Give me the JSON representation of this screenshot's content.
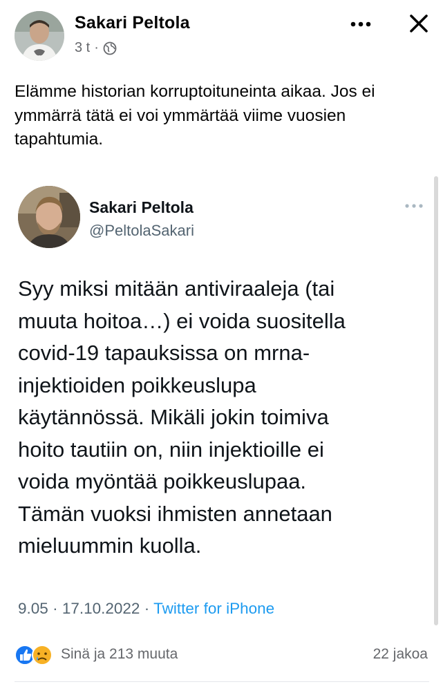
{
  "post": {
    "author_name": "Sakari Peltola",
    "time_ago": "3 t",
    "separator": "·",
    "audience_icon": "globe-icon",
    "text": "Elämme historian korruptoituneinta aikaa. Jos ei ymmärrä tätä ei voi ymmärtää viime vuosien tapahtumia."
  },
  "header_actions": {
    "more_icon": "more-dots-icon",
    "close_icon": "close-icon"
  },
  "tweet": {
    "name": "Sakari Peltola",
    "handle": "@PeltolaSakari",
    "lines": [
      "Syy miksi mitään antiviraaleja (tai",
      "muuta hoitoa…) ei voida suositella",
      "covid-19 tapauksissa on mrna-",
      "injektioiden poikkeuslupa",
      "käytännössä. Mikäli jokin toimiva",
      "hoito tautiin on, niin injektioille ei",
      "voida myöntää poikkeuslupaa.",
      "Tämän vuoksi ihmisten annetaan",
      "mieluummin kuolla."
    ],
    "time": "9.05",
    "date": "17.10.2022",
    "dot": "·",
    "source": "Twitter for iPhone"
  },
  "reactions": {
    "icons": [
      "like-icon",
      "sad-icon"
    ],
    "count_text": "Sinä ja 213 muuta",
    "shares_text": "22 jakoa"
  },
  "colors": {
    "like_blue": "#1877f2",
    "sad_yellow": "#f7b125",
    "twitter_blue": "#1d9bf0",
    "meta_gray": "#65676b"
  }
}
